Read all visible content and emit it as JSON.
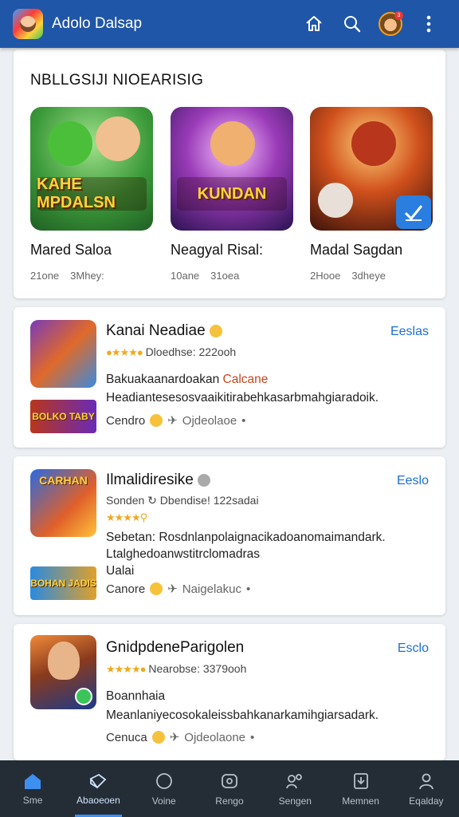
{
  "header": {
    "title": "Adolo Dalsap",
    "accent": "#1f56a8",
    "icons": [
      "app-logo",
      "home-icon",
      "search-icon",
      "avatar",
      "more-vert-icon"
    ]
  },
  "featured": {
    "section_title": "NBLLGSIJI NIOEARISIG",
    "items": [
      {
        "name": "Mared Saloa",
        "meta1": "21one",
        "meta2": "3Mhey:",
        "banner": "KAHE MPDALSN"
      },
      {
        "name": "Neagyal Risal:",
        "meta1": "10ane",
        "meta2": "31oea",
        "banner": "KUNDAN"
      },
      {
        "name": "Madal Sagdan",
        "meta1": "2Hooe",
        "meta2": "3dheye",
        "banner": ""
      }
    ]
  },
  "list": [
    {
      "title": "Kanai Neadiae",
      "action": "Eeslas",
      "sub": "Dloedhse: 222ooh",
      "body1": "Bakuakaanardoakan",
      "body1_tag": "Calcane",
      "body2": "Headiantesesosvaaikitirabehkasarbmahgiaradoik.",
      "body3": "",
      "foot_left": "Cendro",
      "foot_right": "Ojdeolaoe",
      "banner": "BOLKO TABY"
    },
    {
      "title": "Ilmalidiresike",
      "action": "Eeslo",
      "sub": "Sonden",
      "sub2": "Dbendise! 122sadai",
      "body1": "Sebetan: Rosdnlanpolaignacikadoanomaimandark.",
      "body1_tag": "",
      "body2": "Ltalghedoanwstitrclomadras",
      "body3": "Ualai",
      "foot_left": "Canore",
      "foot_right": "Naigelakuc",
      "thumb_text": "CARHAN",
      "banner": "BOHAN JADIS"
    },
    {
      "title": "GnidpdeneParigolen",
      "action": "Esclo",
      "sub": "Nearobse: 3379ooh",
      "body1": "Boannhaia",
      "body1_tag": "",
      "body2": "Meanlaniyecosokaleissbahkanarkamihgiarsadark.",
      "body3": "",
      "foot_left": "Cenuca",
      "foot_right": "Ojdeolaone",
      "banner": ""
    }
  ],
  "bottom_nav": [
    {
      "label": "Sme",
      "icon": "home-icon",
      "active": false
    },
    {
      "label": "Abaoeoen",
      "icon": "cards-icon",
      "active": true
    },
    {
      "label": "Voine",
      "icon": "circle-icon",
      "active": false
    },
    {
      "label": "Rengo",
      "icon": "game-icon",
      "active": false
    },
    {
      "label": "Sengen",
      "icon": "group-icon",
      "active": false
    },
    {
      "label": "Memnen",
      "icon": "download-icon",
      "active": false
    },
    {
      "label": "Eqalday",
      "icon": "profile-icon",
      "active": false
    }
  ]
}
